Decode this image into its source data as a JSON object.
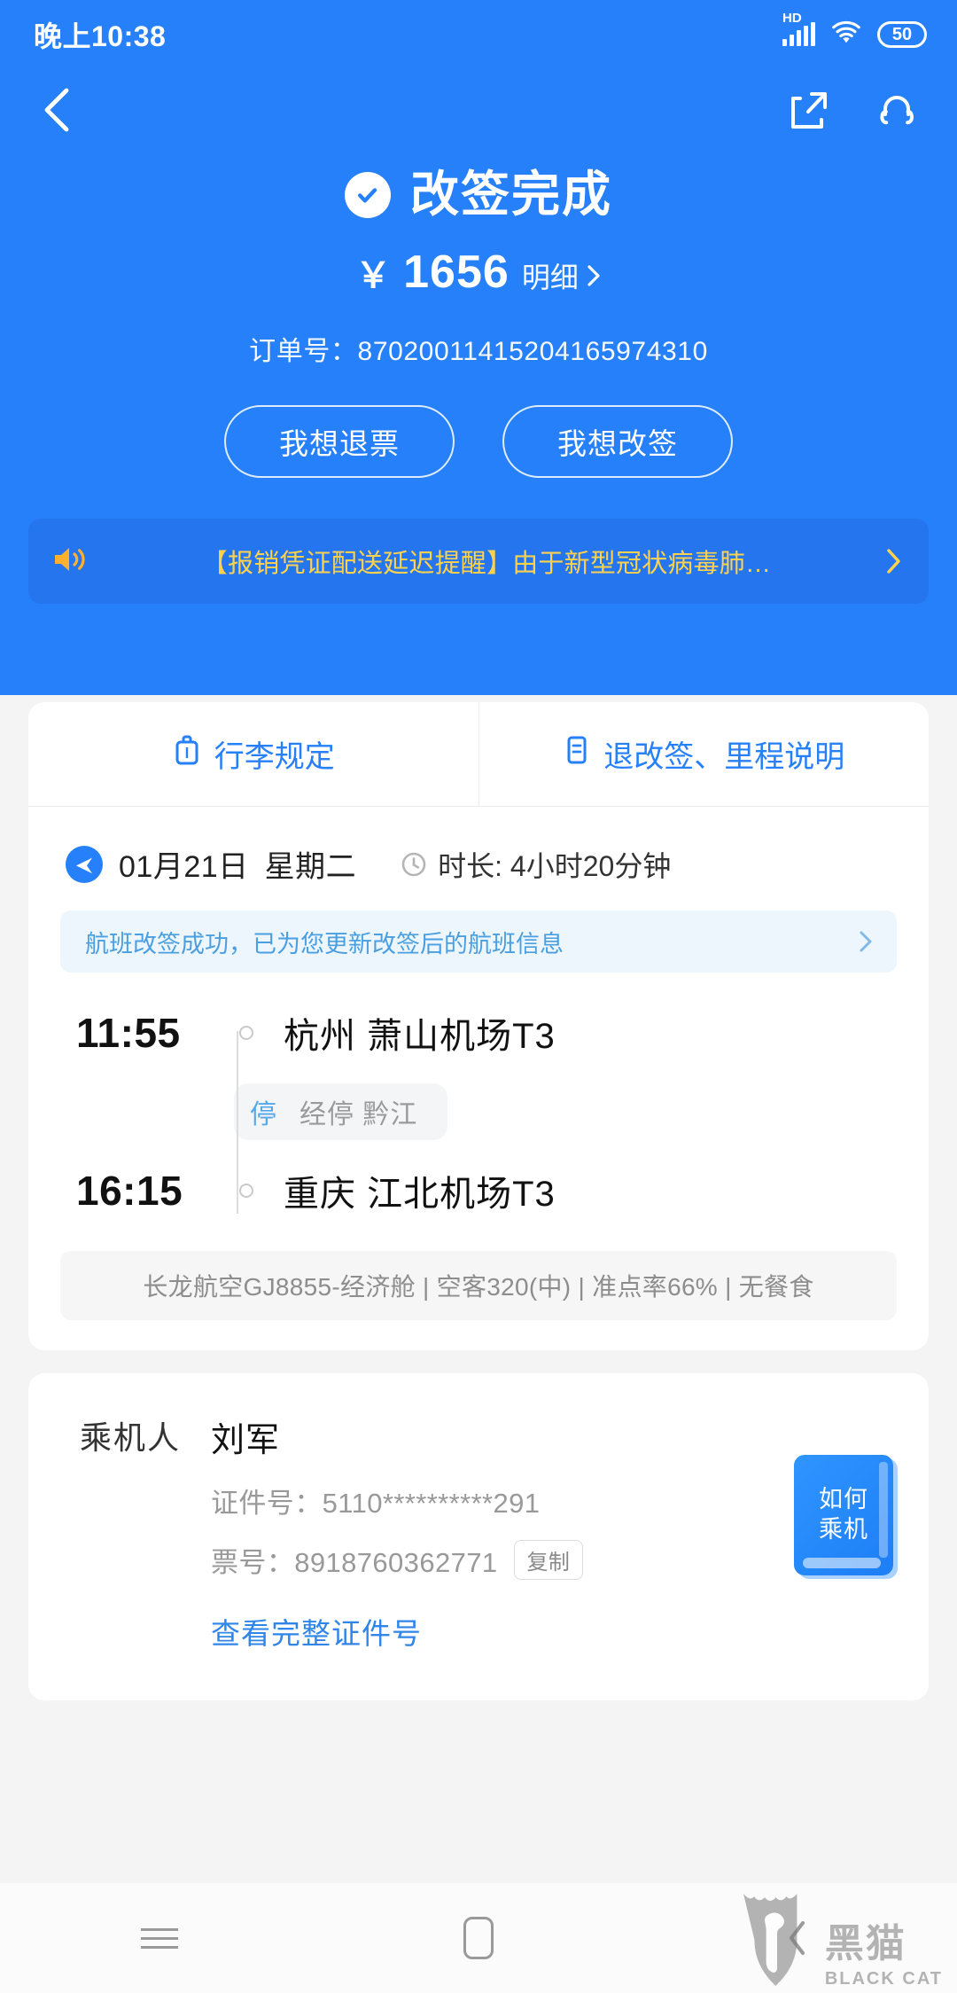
{
  "status_bar": {
    "time": "晚上10:38",
    "hd_label": "HD",
    "battery": "50",
    "signal_icon": "signal-bars-icon",
    "wifi_icon": "wifi-icon",
    "battery_icon": "battery-icon"
  },
  "nav": {
    "back_icon": "chevron-left-icon",
    "share_icon": "share-icon",
    "support_icon": "headset-icon"
  },
  "hero": {
    "check_icon": "check-circle-icon",
    "title": "改签完成",
    "currency": "￥",
    "price": "1656",
    "detail_label": "明细",
    "detail_chevron": "chevron-right-icon",
    "order_label": "订单号：",
    "order_number": "87020011415204165974310",
    "buttons": [
      {
        "label": "我想退票",
        "name": "refund-button"
      },
      {
        "label": "我想改签",
        "name": "rebook-button"
      }
    ]
  },
  "banner": {
    "speaker_icon": "speaker-icon",
    "text": "【报销凭证配送延迟提醒】由于新型冠状病毒肺…",
    "chevron": "chevron-right-icon",
    "text_color": "#ffd24d"
  },
  "flight_card": {
    "tabs": [
      {
        "label": "行李规定",
        "icon": "luggage-icon"
      },
      {
        "label": "退改签、里程说明",
        "icon": "document-icon"
      }
    ],
    "date": "01月21日",
    "weekday": "星期二",
    "duration_label": "时长: 4小时20分钟",
    "clock_icon": "clock-icon",
    "plane_icon": "plane-icon",
    "notice": {
      "text": "航班改签成功，已为您更新改签后的航班信息",
      "chevron": "chevron-right-icon"
    },
    "depart": {
      "time": "11:55",
      "city": "杭州",
      "airport": "萧山机场T3"
    },
    "stopover": {
      "tag": "停",
      "text": "经停 黔江"
    },
    "arrive": {
      "time": "16:15",
      "city": "重庆",
      "airport": "江北机场T3"
    },
    "meta": "长龙航空GJ8855-经济舱 | 空客320(中) | 准点率66% | 无餐食"
  },
  "passenger_card": {
    "label": "乘机人",
    "name": "刘军",
    "id_line": "证件号：5110**********291",
    "ticket_line": "票号：8918760362771",
    "copy_label": "复制",
    "view_full_label": "查看完整证件号",
    "howto_line1": "如何",
    "howto_line2": "乘机"
  },
  "bottom_nav": {
    "menu_icon": "hamburger-menu-icon",
    "home_icon": "home-icon",
    "back_icon": "chevron-left-icon"
  },
  "watermark": {
    "cn": "黑猫",
    "en": "BLACK CAT",
    "icon": "black-cat-logo-icon"
  },
  "colors": {
    "brand_blue": "#2680f9",
    "banner_yellow": "#ffd24d",
    "link_blue": "#2f86e8"
  }
}
